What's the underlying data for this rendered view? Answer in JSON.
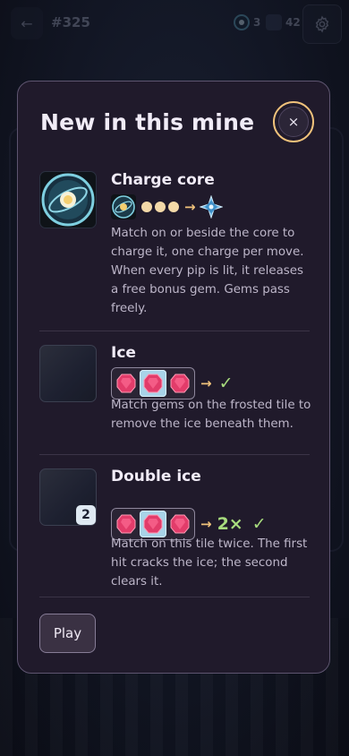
{
  "top_bar": {
    "level": "#325",
    "core_count": "3",
    "gem_count": "42"
  },
  "modal": {
    "title": "New in this mine",
    "close_label": "×",
    "items": [
      {
        "title": "Charge core",
        "description": "Match on or beside the core to charge it, one charge per move. When every pip is lit, it releases a free bonus gem. Gems pass freely.",
        "demo_arrow": "→"
      },
      {
        "title": "Ice",
        "description": "Match gems on the frosted tile to remove the ice beneath them.",
        "demo_arrow": "→",
        "demo_result": "✓"
      },
      {
        "title": "Double ice",
        "description": "Match on this tile twice. The first hit cracks the ice; the second clears it.",
        "badge": "2",
        "demo_arrow": "→",
        "demo_multiplier": "2×",
        "demo_result": "✓"
      }
    ],
    "play_label": "Play"
  },
  "colors": {
    "modal_bg": "#201a2b",
    "accent_gold": "#f0c27b",
    "check_green": "#a8dc7e",
    "gem_red": "#e23c6a",
    "ice_blue": "#a8d3e8"
  },
  "icons": [
    "back-arrow-icon",
    "core-icon",
    "gem-icon",
    "gear-icon",
    "close-icon",
    "charge-core-icon",
    "pip-icon",
    "burst-gem-icon",
    "ruby-gem-icon",
    "check-icon"
  ]
}
